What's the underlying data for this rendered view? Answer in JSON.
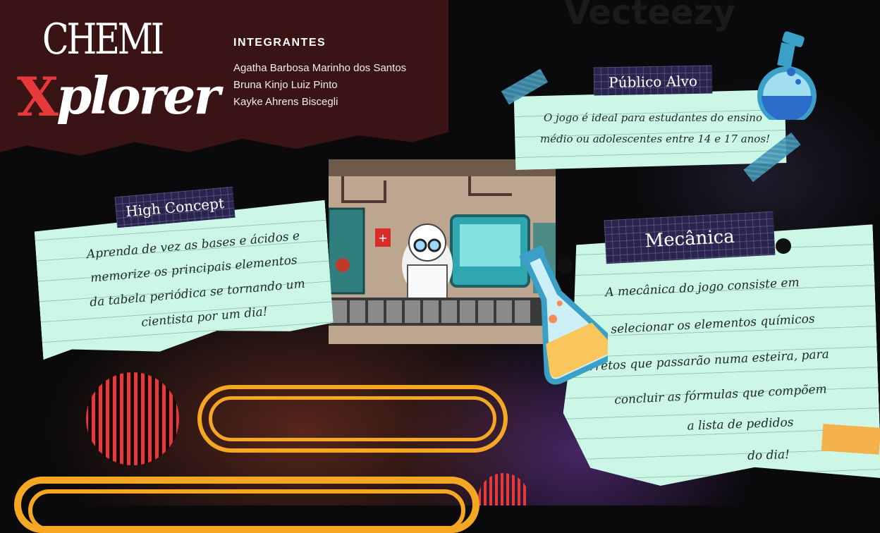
{
  "title": {
    "line1": "CHEMI",
    "line2_x": "X",
    "line2_rest": "plorer"
  },
  "members": {
    "heading": "INTEGRANTES",
    "names": [
      "Agatha Barbosa Marinho dos Santos",
      "Bruna Kinjo Luiz Pinto",
      "Kayke Ahrens Biscegli"
    ]
  },
  "publico": {
    "label": "Público Alvo",
    "lines": [
      "O jogo é ideal para estudantes do ensino",
      "médio ou adolescentes entre 14 e 17 anos!"
    ]
  },
  "high_concept": {
    "label": "High Concept",
    "lines": [
      "Aprenda de vez as bases e ácidos e",
      "memorize os principais elementos",
      "da tabela periódica se tornando um",
      "cientista por um dia!"
    ]
  },
  "mecanica": {
    "label": "Mecânica",
    "lines": [
      "A mecânica do jogo consiste em",
      "selecionar os elementos químicos",
      "corretos que passarão numa esteira, para",
      "concluir as fórmulas que compõem",
      "a lista de pedidos",
      "do dia!"
    ]
  },
  "watermark": "Vecteezy",
  "colors": {
    "note": "#ccf6e6",
    "accent_red": "#e8393a",
    "accent_orange": "#f5a623",
    "tag_bg": "#2a2550",
    "header_bg": "#3a1414"
  },
  "icons": [
    "round-flask-icon",
    "erlenmeyer-flask-icon",
    "scientist-illustration"
  ]
}
